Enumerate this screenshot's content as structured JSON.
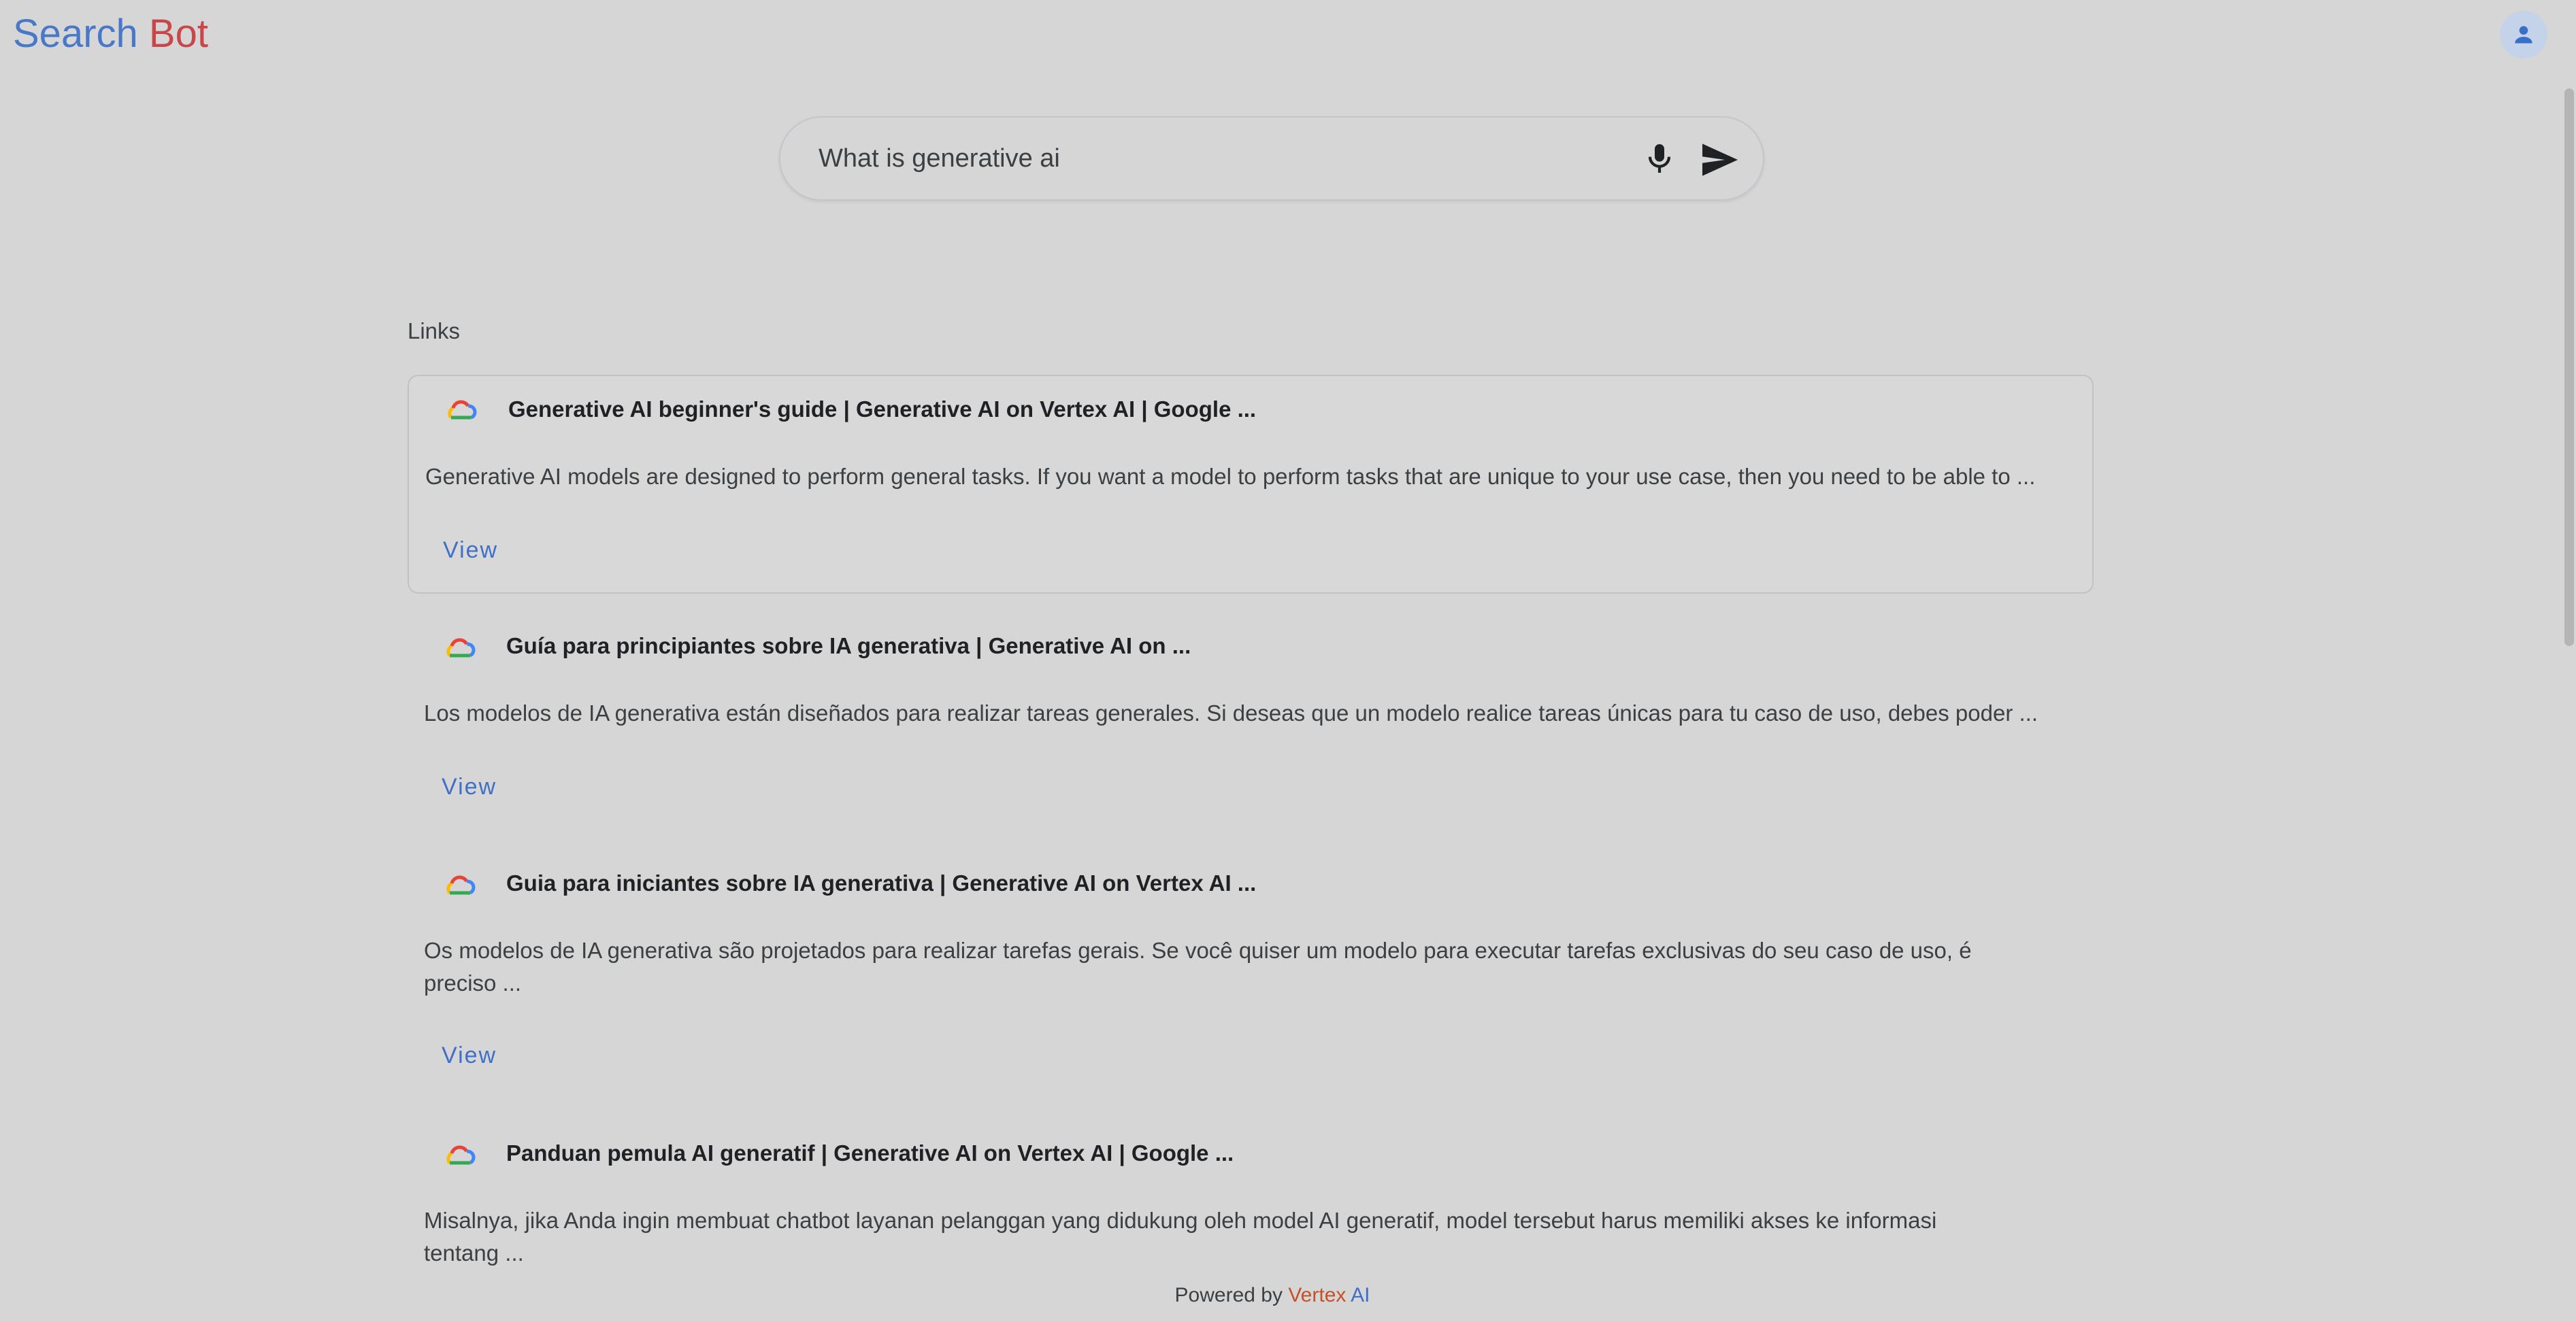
{
  "header": {
    "logo_word1": "Search",
    "logo_word2": "Bot",
    "logo_colors": [
      "#4a78c9",
      "#c8484a"
    ],
    "avatar_icon": "account-icon"
  },
  "search": {
    "query": "What is generative ai",
    "mic_icon": "microphone-icon",
    "send_icon": "send-icon"
  },
  "links": {
    "label": "Links",
    "results": [
      {
        "icon": "google-cloud-icon",
        "title": "Generative AI beginner's guide | Generative AI on Vertex AI | Google ...",
        "snippet": "Generative AI models are designed to perform general tasks. If you want a model to perform tasks that are unique to your use case, then you need to be able to ...",
        "view_label": "View"
      },
      {
        "icon": "google-cloud-icon",
        "title": "Guía para principiantes sobre IA generativa | Generative AI on ...",
        "snippet": "Los modelos de IA generativa están diseñados para realizar tareas generales. Si deseas que un modelo realice tareas únicas para tu caso de uso, debes poder ...",
        "view_label": "View"
      },
      {
        "icon": "google-cloud-icon",
        "title": "Guia para iniciantes sobre IA generativa | Generative AI on Vertex AI ...",
        "snippet": "Os modelos de IA generativa são projetados para realizar tarefas gerais. Se você quiser um modelo para executar tarefas exclusivas do seu caso de uso, é preciso ...",
        "view_label": "View"
      },
      {
        "icon": "google-cloud-icon",
        "title": "Panduan pemula AI generatif | Generative AI on Vertex AI | Google ...",
        "snippet": "Misalnya, jika Anda ingin membuat chatbot layanan pelanggan yang didukung oleh model AI generatif, model tersebut harus memiliki akses ke informasi tentang ..."
      }
    ]
  },
  "footer": {
    "prefix": "Powered by",
    "brand_part1": "Vertex",
    "brand_part2": "AI"
  },
  "colors": {
    "background": "#d6d6d6",
    "link": "#3f6fc6",
    "avatar_bg": "#c4d3ea"
  }
}
